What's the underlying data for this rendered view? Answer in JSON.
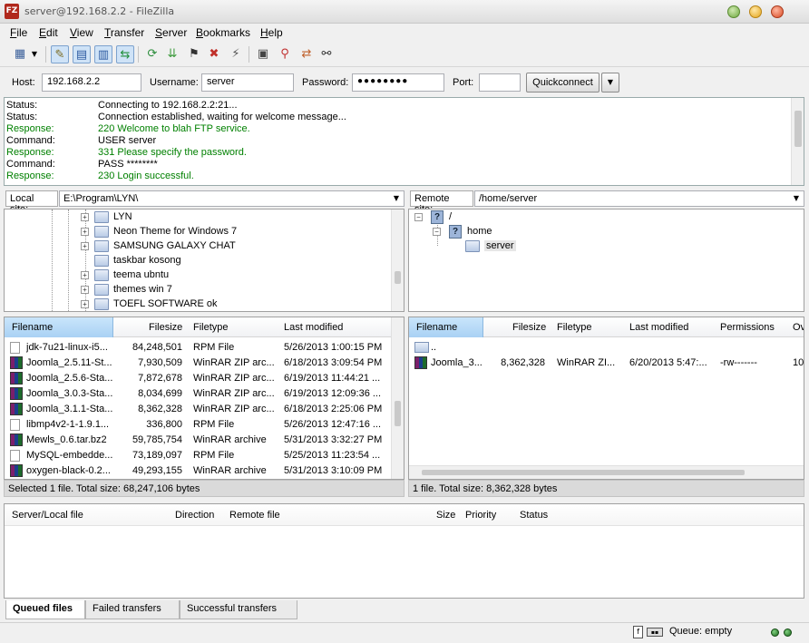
{
  "window": {
    "title": "server@192.168.2.2 - FileZilla",
    "app_icon_text": "FZ"
  },
  "menu": [
    "File",
    "Edit",
    "View",
    "Transfer",
    "Server",
    "Bookmarks",
    "Help"
  ],
  "quickconnect": {
    "host_label": "Host:",
    "host_value": "192.168.2.2",
    "username_label": "Username:",
    "username_value": "server",
    "password_label": "Password:",
    "password_value": "●●●●●●●●",
    "port_label": "Port:",
    "port_value": "",
    "button_label": "Quickconnect"
  },
  "log": [
    {
      "type": "Status:",
      "message": "Connecting to 192.168.2.2:21...",
      "color": "#000000"
    },
    {
      "type": "Status:",
      "message": "Connection established, waiting for welcome message...",
      "color": "#000000"
    },
    {
      "type": "Response:",
      "message": "220 Welcome to blah FTP service.",
      "color": "#008000"
    },
    {
      "type": "Command:",
      "message": "USER server",
      "color": "#000000"
    },
    {
      "type": "Response:",
      "message": "331 Please specify the password.",
      "color": "#008000"
    },
    {
      "type": "Command:",
      "message": "PASS ********",
      "color": "#000000"
    },
    {
      "type": "Response:",
      "message": "230 Login successful.",
      "color": "#008000"
    }
  ],
  "local": {
    "site_label": "Local site:",
    "path": "E:\\Program\\LYN\\",
    "tree": [
      "LYN",
      "Neon Theme for Windows 7",
      "SAMSUNG GALAXY CHAT",
      "taskbar kosong",
      "teema ubntu",
      "themes win 7",
      "TOEFL SOFTWARE ok"
    ],
    "columns": [
      "Filename",
      "Filesize",
      "Filetype",
      "Last modified"
    ],
    "files": [
      {
        "name": "jdk-7u21-linux-i5...",
        "size": "84,248,501",
        "type": "RPM File",
        "modified": "5/26/2013 1:00:15 PM",
        "icon": "doc"
      },
      {
        "name": "Joomla_2.5.11-St...",
        "size": "7,930,509",
        "type": "WinRAR ZIP arc...",
        "modified": "6/18/2013 3:09:54 PM",
        "icon": "rar"
      },
      {
        "name": "Joomla_2.5.6-Sta...",
        "size": "7,872,678",
        "type": "WinRAR ZIP arc...",
        "modified": "6/19/2013 11:44:21 ...",
        "icon": "rar"
      },
      {
        "name": "Joomla_3.0.3-Sta...",
        "size": "8,034,699",
        "type": "WinRAR ZIP arc...",
        "modified": "6/19/2013 12:09:36 ...",
        "icon": "rar"
      },
      {
        "name": "Joomla_3.1.1-Sta...",
        "size": "8,362,328",
        "type": "WinRAR ZIP arc...",
        "modified": "6/18/2013 2:25:06 PM",
        "icon": "rar"
      },
      {
        "name": "libmp4v2-1-1.9.1...",
        "size": "336,800",
        "type": "RPM File",
        "modified": "5/26/2013 12:47:16 ...",
        "icon": "doc"
      },
      {
        "name": "Mewls_0.6.tar.bz2",
        "size": "59,785,754",
        "type": "WinRAR archive",
        "modified": "5/31/2013 3:32:27 PM",
        "icon": "rar"
      },
      {
        "name": "MySQL-embedde...",
        "size": "73,189,097",
        "type": "RPM File",
        "modified": "5/25/2013 11:23:54 ...",
        "icon": "doc"
      },
      {
        "name": "oxygen-black-0.2...",
        "size": "49,293,155",
        "type": "WinRAR archive",
        "modified": "5/31/2013 3:10:09 PM",
        "icon": "rar"
      }
    ],
    "status": "Selected 1 file. Total size: 68,247,106 bytes"
  },
  "remote": {
    "site_label": "Remote site:",
    "path": "/home/server",
    "tree": [
      "/",
      "home",
      "server"
    ],
    "columns": [
      "Filename",
      "Filesize",
      "Filetype",
      "Last modified",
      "Permissions",
      "Ov"
    ],
    "parent_label": "..",
    "files": [
      {
        "name": "Joomla_3...",
        "size": "8,362,328",
        "type": "WinRAR ZI...",
        "modified": "6/20/2013 5:47:...",
        "permissions": "-rw-------",
        "owner": "10"
      }
    ],
    "status": "1 file. Total size: 8,362,328 bytes"
  },
  "queue": {
    "columns": [
      "Server/Local file",
      "Direction",
      "Remote file",
      "Size",
      "Priority",
      "Status"
    ],
    "tabs": [
      "Queued files",
      "Failed transfers",
      "Successful transfers"
    ],
    "status": "Queue: empty"
  }
}
